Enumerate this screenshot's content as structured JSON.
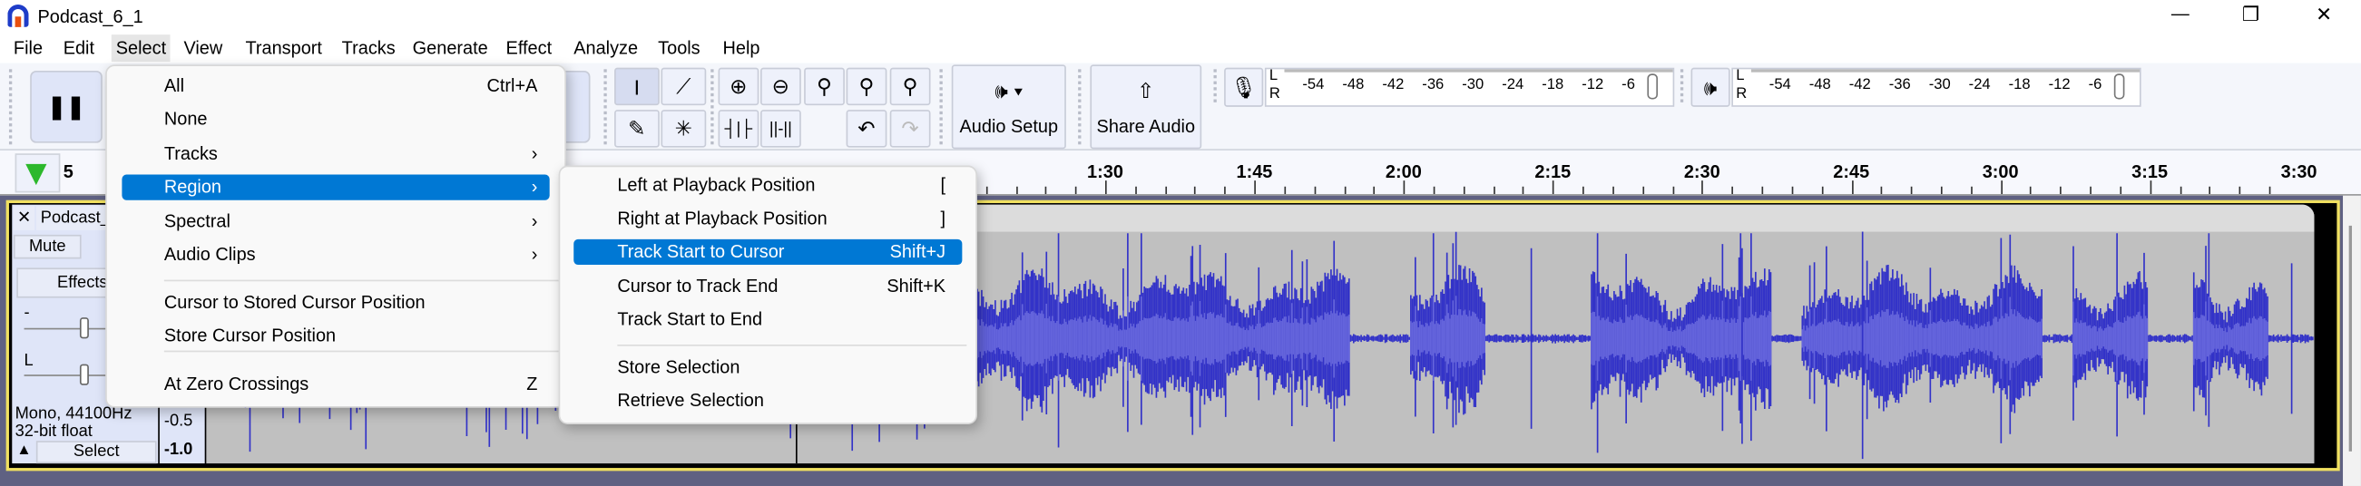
{
  "window": {
    "title": "Podcast_6_1",
    "minimize": "—",
    "restore": "❐",
    "close": "✕"
  },
  "menubar": [
    "File",
    "Edit",
    "Select",
    "View",
    "Transport",
    "Tracks",
    "Generate",
    "Effect",
    "Analyze",
    "Tools",
    "Help"
  ],
  "toolbar": {
    "audio_setup": "Audio Setup",
    "share_audio": "Share Audio",
    "meter_scale": [
      "-54",
      "-48",
      "-42",
      "-36",
      "-30",
      "-24",
      "-18",
      "-12",
      "-6"
    ],
    "lr": [
      "L",
      "R"
    ]
  },
  "timeline": {
    "start_label": "5",
    "ticks": [
      "1:30",
      "1:45",
      "2:00",
      "2:15",
      "2:30",
      "2:45",
      "3:00",
      "3:15",
      "3:30"
    ]
  },
  "track": {
    "name": "Podcast_",
    "mute": "Mute",
    "effects": "Effects",
    "gain_label": "-",
    "pan_label": "L",
    "format1": "Mono, 44100Hz",
    "format2": "32-bit float",
    "select": "Select",
    "collapse": "▲",
    "close": "✕",
    "scale": [
      "-0.5",
      "-1.0"
    ],
    "wave_color": "#3232c8"
  },
  "select_menu": {
    "items": [
      {
        "label": "All",
        "shortcut": "Ctrl+A"
      },
      {
        "label": "None",
        "shortcut": ""
      },
      {
        "label": "Tracks",
        "shortcut": "›"
      },
      {
        "label": "Region",
        "shortcut": "›"
      },
      {
        "label": "Spectral",
        "shortcut": "›"
      },
      {
        "label": "Audio Clips",
        "shortcut": "›"
      },
      {
        "label": "Cursor to Stored Cursor Position",
        "shortcut": ""
      },
      {
        "label": "Store Cursor Position",
        "shortcut": ""
      },
      {
        "label": "At Zero Crossings",
        "shortcut": "Z"
      }
    ]
  },
  "region_submenu": {
    "items": [
      {
        "label": "Left at Playback Position",
        "shortcut": "["
      },
      {
        "label": "Right at Playback Position",
        "shortcut": "]"
      },
      {
        "label": "Track Start to Cursor",
        "shortcut": "Shift+J"
      },
      {
        "label": "Cursor to Track End",
        "shortcut": "Shift+K"
      },
      {
        "label": "Track Start to End",
        "shortcut": ""
      },
      {
        "label": "Store Selection",
        "shortcut": ""
      },
      {
        "label": "Retrieve Selection",
        "shortcut": ""
      }
    ]
  },
  "colors": {
    "highlight": "#0078d4",
    "track_border": "#f0e060"
  }
}
